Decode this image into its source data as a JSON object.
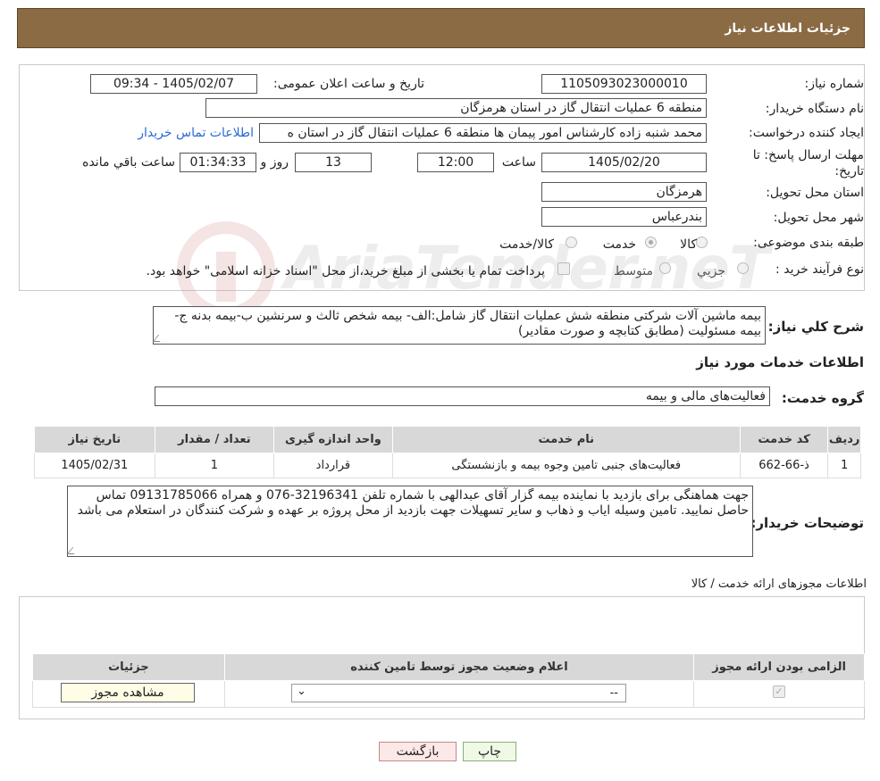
{
  "header": {
    "title": "جزئیات اطلاعات نیاز"
  },
  "watermark": {
    "text": "AriaTender.neT"
  },
  "form": {
    "need_number_label": "شماره نیاز:",
    "need_number": "1105093023000010",
    "announce_label": "تاریخ و ساعت اعلان عمومی:",
    "announce_value": "1405/02/07 - 09:34",
    "buyer_label": "نام دستگاه خریدار:",
    "buyer_value": "منطقه 6 عملیات انتقال گاز در استان هرمزگان",
    "creator_label": "ایجاد کننده درخواست:",
    "creator_value": "محمد شنبه زاده کارشناس امور پیمان ها منطقه 6 عملیات انتقال گاز در استان ه",
    "contact_link": "اطلاعات تماس خریدار",
    "deadline_label_1": "مهلت ارسال پاسخ: تا",
    "deadline_label_2": "تاریخ:",
    "deadline_date": "1405/02/20",
    "time_label": "ساعت",
    "deadline_time": "12:00",
    "days_value": "13",
    "days_label": "روز و",
    "remaining_value": "01:34:33",
    "remaining_label": "ساعت باقي مانده",
    "province_label": "استان محل تحویل:",
    "province_value": "هرمزگان",
    "city_label": "شهر محل تحویل:",
    "city_value": "بندرعباس",
    "category_label": "طبقه بندی موضوعی:",
    "category_options": [
      "کالا",
      "خدمت",
      "کالا/خدمت"
    ],
    "category_selected": "خدمت",
    "process_label": "نوع فرآیند خرید :",
    "process_options": [
      "جزیي",
      "متوسط"
    ],
    "process_note": "پرداخت تمام یا بخشی از مبلغ خرید،از محل \"اسناد خزانه اسلامی\" خواهد بود."
  },
  "summary": {
    "label": "شرح کلي نياز:",
    "text": "بیمه ماشین آلات شرکتی منطقه شش عملیات انتقال گاز شامل:الف- بیمه شخص ثالث و سرنشین ب-بیمه بدنه ج- بیمه مسئولیت (مطابق کتابچه و صورت مقادیر)"
  },
  "services": {
    "section_title": "اطلاعات خدمات مورد نیاز",
    "group_label": "گروه خدمت:",
    "group_value": "فعالیت‌های مالی و بیمه",
    "columns": [
      "رديف",
      "کد خدمت",
      "نام خدمت",
      "واحد اندازه گیری",
      "تعداد / مقدار",
      "تاریخ نیاز"
    ],
    "rows": [
      {
        "row": "1",
        "code": "ذ-66-662",
        "name": "فعالیت‌های جنبی تامین وجوه بیمه و بازنشستگی",
        "unit": "قرارداد",
        "qty": "1",
        "date": "1405/02/31"
      }
    ]
  },
  "buyer_notes": {
    "label": "توضیحات خریدار:",
    "text": "جهت هماهنگی برای بازدید با نماینده  بیمه  گزار  آقای عبدالهی  با شماره تلفن 32196341-076 و همراه 09131785066 تماس حاصل نمایید. تامین وسیله ایاب و ذهاب و سایر تسهیلات جهت بازدید از محل پروژه بر عهده و شرکت کنندگان در استعلام می باشد"
  },
  "permits": {
    "section_title": "اطلاعات مجوزهای ارائه خدمت / کالا",
    "columns": [
      "الزامی بودن ارائه مجوز",
      "اعلام وضعیت مجوز توسط تامین کننده",
      "جزئیات"
    ],
    "select_value": "--",
    "view_button": "مشاهده مجوز"
  },
  "footer": {
    "print_button": "چاپ",
    "back_button": "بازگشت"
  }
}
